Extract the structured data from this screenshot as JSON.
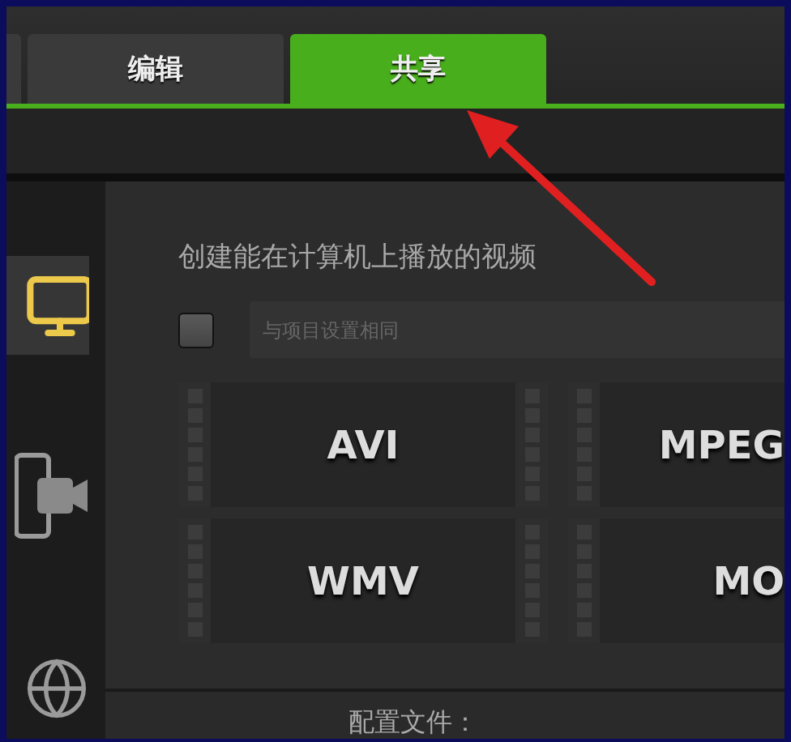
{
  "tabs": [
    {
      "label": "编辑",
      "selected": false
    },
    {
      "label": "共享",
      "selected": true
    }
  ],
  "sidebar": {
    "items": [
      {
        "kind": "computer",
        "selected": true
      },
      {
        "kind": "device",
        "selected": false
      },
      {
        "kind": "web",
        "selected": false
      }
    ]
  },
  "content": {
    "title": "创建能在计算机上播放的视频",
    "same_as_project": {
      "checked": false,
      "placeholder": "与项目设置相同"
    },
    "formats": [
      {
        "label": "AVI"
      },
      {
        "label": "MPEG"
      },
      {
        "label": "WMV"
      },
      {
        "label": "MO"
      }
    ],
    "profile_label": "配置文件："
  }
}
